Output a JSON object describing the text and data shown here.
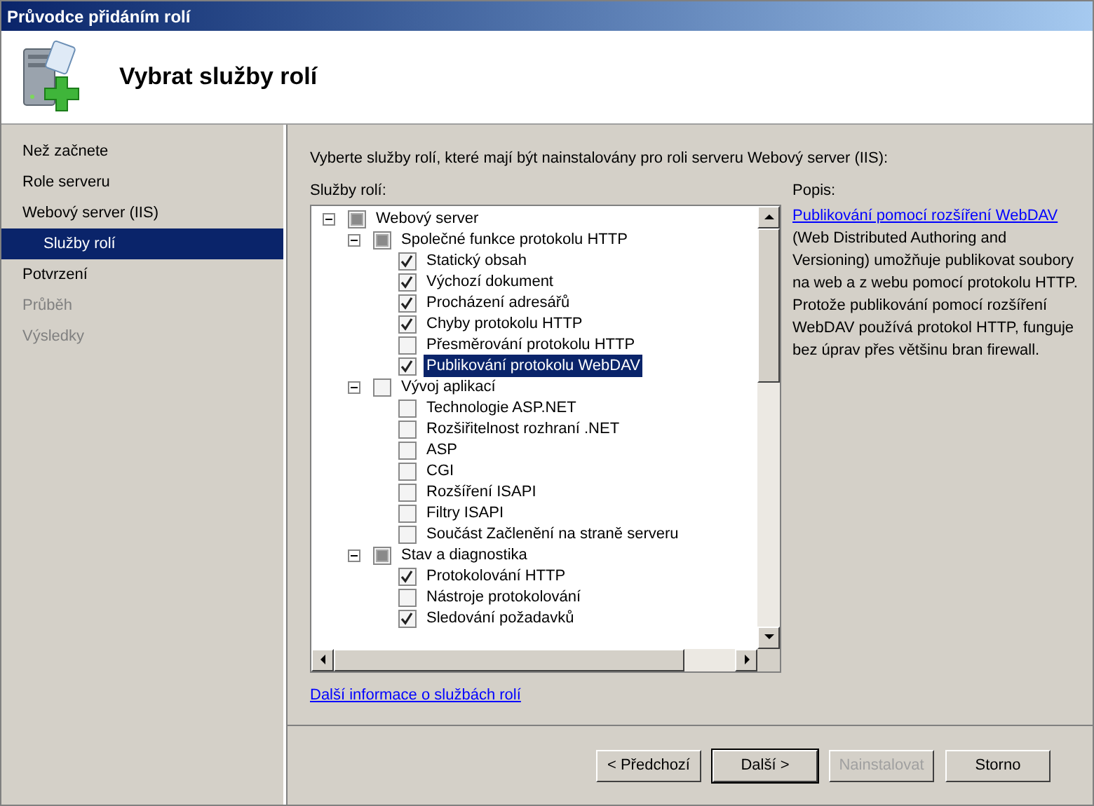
{
  "window": {
    "title": "Průvodce přidáním rolí"
  },
  "header": {
    "title": "Vybrat služby rolí"
  },
  "sidebar": {
    "items": [
      {
        "label": "Než začnete",
        "selected": false,
        "disabled": false
      },
      {
        "label": "Role serveru",
        "selected": false,
        "disabled": false
      },
      {
        "label": "Webový server (IIS)",
        "selected": false,
        "disabled": false,
        "children": [
          {
            "label": "Služby rolí",
            "selected": true
          }
        ]
      },
      {
        "label": "Potvrzení",
        "selected": false,
        "disabled": false
      },
      {
        "label": "Průběh",
        "selected": false,
        "disabled": true
      },
      {
        "label": "Výsledky",
        "selected": false,
        "disabled": true
      }
    ]
  },
  "intro": "Vyberte služby rolí, které mají být nainstalovány pro roli serveru Webový server (IIS):",
  "services": {
    "label": "Služby rolí:",
    "tree": [
      {
        "label": "Webový server",
        "checked": false,
        "partial": true,
        "expanded": true,
        "selected": false,
        "children": [
          {
            "label": "Společné funkce protokolu HTTP",
            "checked": false,
            "partial": true,
            "expanded": true,
            "selected": false,
            "children": [
              {
                "label": "Statický obsah",
                "checked": true,
                "selected": false
              },
              {
                "label": "Výchozí dokument",
                "checked": true,
                "selected": false
              },
              {
                "label": "Procházení adresářů",
                "checked": true,
                "selected": false
              },
              {
                "label": "Chyby protokolu HTTP",
                "checked": true,
                "selected": false
              },
              {
                "label": "Přesměrování protokolu HTTP",
                "checked": false,
                "selected": false
              },
              {
                "label": "Publikování protokolu WebDAV",
                "checked": true,
                "selected": true
              }
            ]
          },
          {
            "label": "Vývoj aplikací",
            "checked": false,
            "partial": false,
            "expanded": true,
            "selected": false,
            "children": [
              {
                "label": "Technologie ASP.NET",
                "checked": false,
                "selected": false
              },
              {
                "label": "Rozšiřitelnost rozhraní .NET",
                "checked": false,
                "selected": false
              },
              {
                "label": "ASP",
                "checked": false,
                "selected": false
              },
              {
                "label": "CGI",
                "checked": false,
                "selected": false
              },
              {
                "label": "Rozšíření ISAPI",
                "checked": false,
                "selected": false
              },
              {
                "label": "Filtry ISAPI",
                "checked": false,
                "selected": false
              },
              {
                "label": "Součást Začlenění na straně serveru",
                "checked": false,
                "selected": false
              }
            ]
          },
          {
            "label": "Stav a diagnostika",
            "checked": false,
            "partial": true,
            "expanded": true,
            "selected": false,
            "children": [
              {
                "label": "Protokolování HTTP",
                "checked": true,
                "selected": false
              },
              {
                "label": "Nástroje protokolování",
                "checked": false,
                "selected": false
              },
              {
                "label": "Sledování požadavků",
                "checked": true,
                "selected": false
              }
            ]
          }
        ]
      }
    ]
  },
  "more_link": "Další informace o službách rolí",
  "description": {
    "label": "Popis:",
    "link": "Publikování pomocí rozšíření WebDAV",
    "text": " (Web Distributed Authoring and Versioning) umožňuje publikovat soubory na web a z webu pomocí protokolu HTTP. Protože publikování pomocí rozšíření WebDAV používá protokol HTTP, funguje bez úprav přes většinu bran firewall."
  },
  "buttons": [
    {
      "label": "< Předchozí",
      "disabled": false,
      "default": false
    },
    {
      "label": "Další >",
      "disabled": false,
      "default": true
    },
    {
      "label": "Nainstalovat",
      "disabled": true,
      "default": false
    },
    {
      "label": "Storno",
      "disabled": false,
      "default": false
    }
  ]
}
